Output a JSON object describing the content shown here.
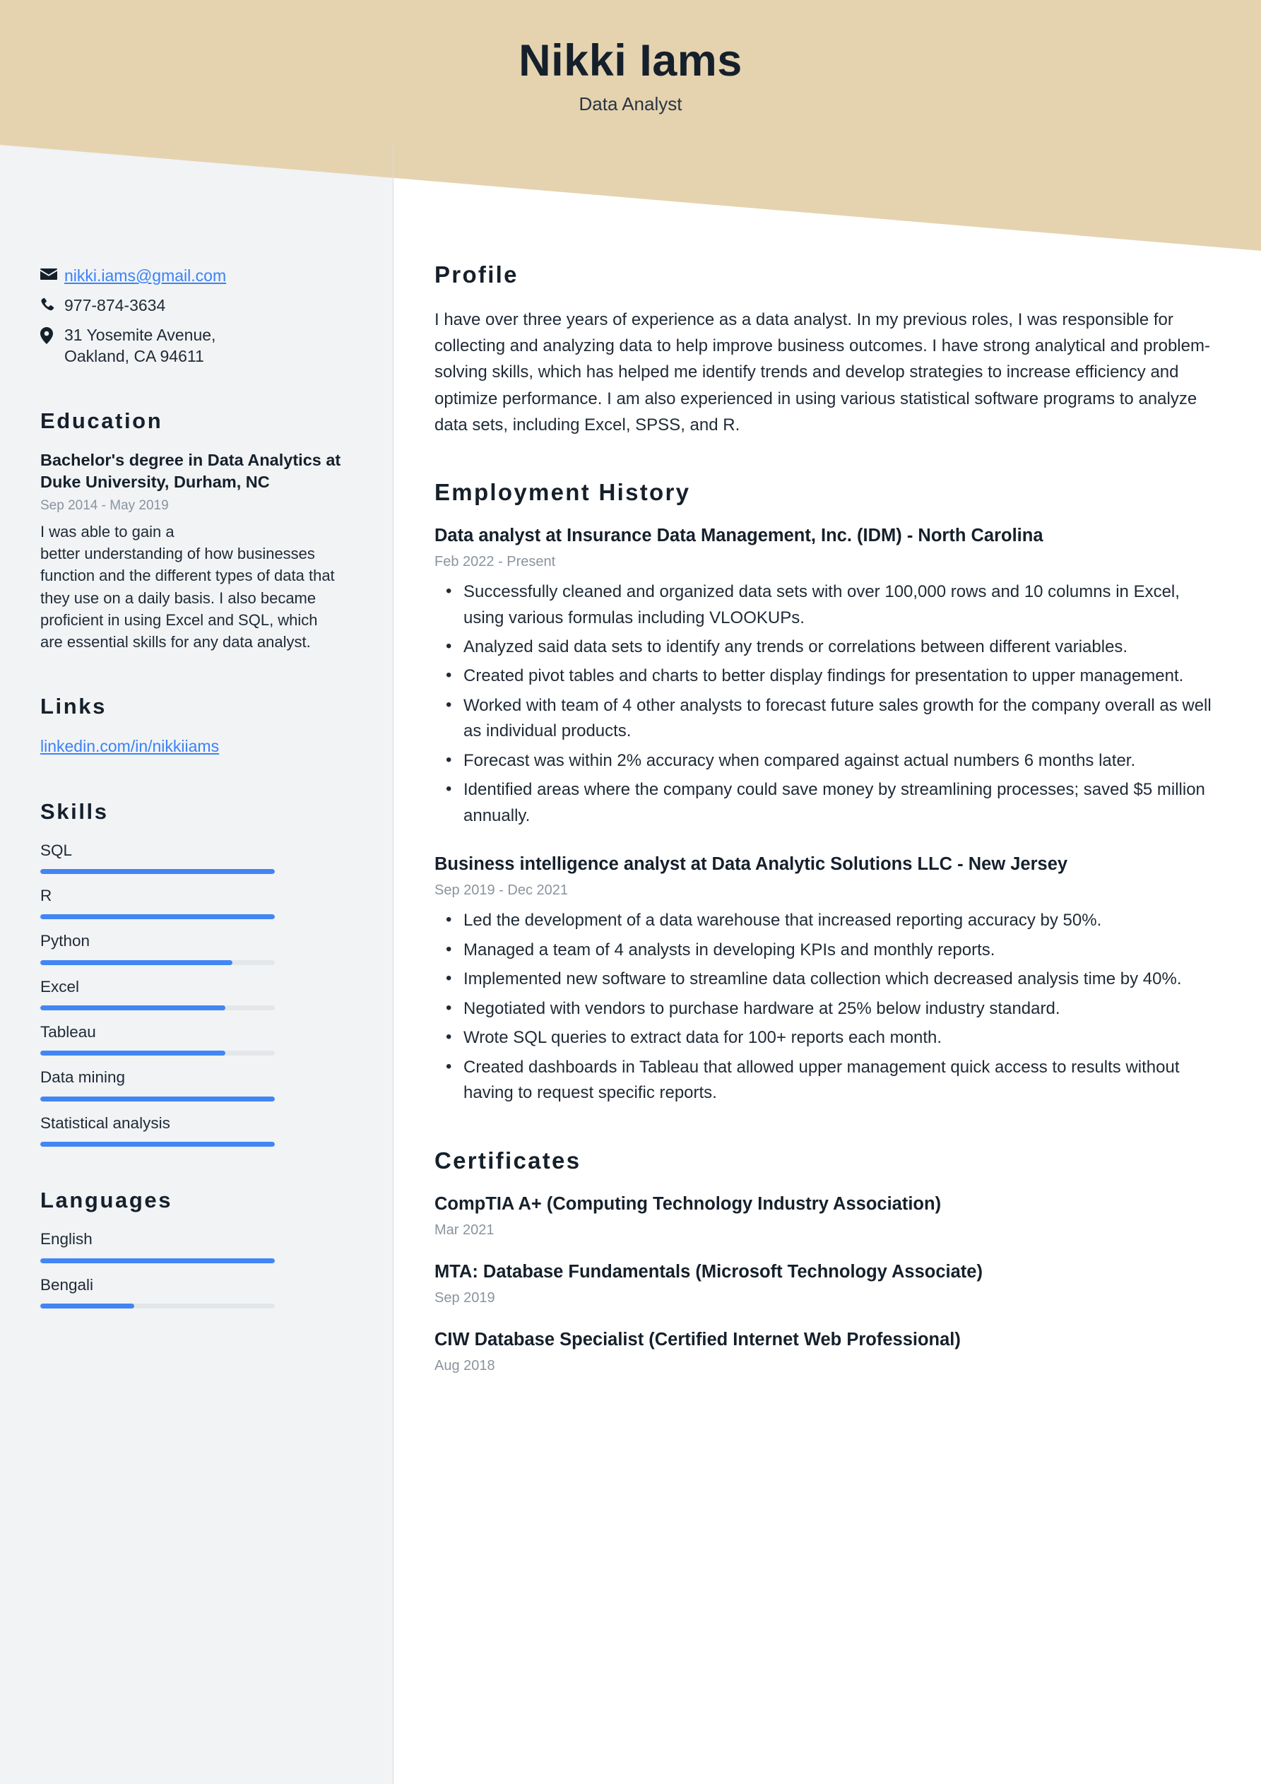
{
  "header": {
    "name": "Nikki Iams",
    "job_title": "Data Analyst",
    "band_color": "#e5d3b0"
  },
  "sidebar": {
    "background_color": "#f1f3f5",
    "contact": {
      "email": "nikki.iams@gmail.com",
      "phone": "977-874-3634",
      "address_line1": "31 Yosemite Avenue,",
      "address_line2": "Oakland, CA 94611"
    },
    "education": {
      "heading": "Education",
      "degree": "Bachelor's degree in Data Analytics at Duke University, Durham, NC",
      "dates": "Sep 2014 - May 2019",
      "description": "I was able to gain a\nbetter understanding of how businesses function and the different types of data that they use on a daily basis. I also became proficient in using Excel and SQL, which are essential skills for any data analyst."
    },
    "links": {
      "heading": "Links",
      "items": [
        {
          "label": "linkedin.com/in/nikkiiams"
        }
      ]
    },
    "skills": {
      "heading": "Skills",
      "accent_color": "#4285f4",
      "track_color": "#e4e7ea",
      "items": [
        {
          "label": "SQL",
          "level": 100
        },
        {
          "label": "R",
          "level": 100
        },
        {
          "label": "Python",
          "level": 82
        },
        {
          "label": "Excel",
          "level": 79
        },
        {
          "label": "Tableau",
          "level": 79
        },
        {
          "label": "Data mining",
          "level": 100
        },
        {
          "label": "Statistical analysis",
          "level": 100
        }
      ]
    },
    "languages": {
      "heading": "Languages",
      "items": [
        {
          "label": "English",
          "level": 100
        },
        {
          "label": "Bengali",
          "level": 40
        }
      ]
    }
  },
  "main": {
    "profile": {
      "heading": "Profile",
      "text": "I have over three years of experience as a data analyst. In my previous roles, I was responsible for collecting and analyzing data to help improve business outcomes. I have strong analytical and problem-solving skills, which has helped me identify trends and develop strategies to increase efficiency and optimize performance. I am also experienced in using various statistical software programs to analyze data sets, including Excel, SPSS, and R."
    },
    "employment": {
      "heading": "Employment History",
      "jobs": [
        {
          "title": "Data analyst at Insurance Data Management, Inc. (IDM) - North Carolina",
          "dates": "Feb 2022 - Present",
          "bullets": [
            "Successfully cleaned and organized data sets with over 100,000 rows and 10 columns in Excel, using various formulas including VLOOKUPs.",
            "Analyzed said data sets to identify any trends or correlations between different variables.",
            "Created pivot tables and charts to better display findings for presentation to upper management.",
            "Worked with team of 4 other analysts to forecast future sales growth for the company overall as well as individual products.",
            "Forecast was within 2% accuracy when compared against actual numbers 6 months later.",
            "Identified areas where the company could save money by streamlining processes; saved $5 million annually."
          ]
        },
        {
          "title": "Business intelligence analyst at Data Analytic Solutions LLC - New Jersey",
          "dates": "Sep 2019 - Dec 2021",
          "bullets": [
            "Led the development of a data warehouse that increased reporting accuracy by 50%.",
            "Managed a team of 4 analysts in developing KPIs and monthly reports.",
            "Implemented new software to streamline data collection which decreased analysis time by 40%.",
            "Negotiated with vendors to purchase hardware at 25% below industry standard.",
            "Wrote SQL queries to extract data for 100+ reports each month.",
            "Created dashboards in Tableau that allowed upper management quick access to results without having to request specific reports."
          ]
        }
      ]
    },
    "certificates": {
      "heading": "Certificates",
      "items": [
        {
          "name": "CompTIA A+ (Computing Technology Industry Association)",
          "date": "Mar 2021"
        },
        {
          "name": "MTA: Database Fundamentals (Microsoft Technology Associate)",
          "date": "Sep 2019"
        },
        {
          "name": "CIW Database Specialist (Certified Internet Web Professional)",
          "date": "Aug 2018"
        }
      ]
    }
  }
}
